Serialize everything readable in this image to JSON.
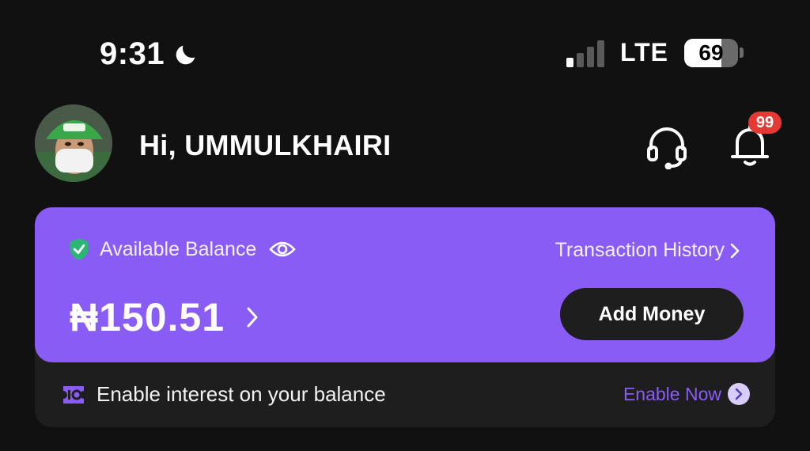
{
  "status_bar": {
    "time": "9:31",
    "network": "LTE",
    "battery": "69",
    "battery_level": 0.69,
    "icons": [
      "moon-icon",
      "signal-icon",
      "battery-icon"
    ]
  },
  "header": {
    "greeting": "Hi, UMMULKHAIRI",
    "notification_count": "99",
    "icons": [
      "avatar",
      "headset-icon",
      "bell-icon"
    ]
  },
  "balance_card": {
    "label": "Available Balance",
    "amount": "₦150.51",
    "transaction_history": "Transaction History",
    "add_money": "Add Money",
    "icons": [
      "shield-check-icon",
      "eye-icon",
      "chevron-right-icon"
    ]
  },
  "interest_banner": {
    "text": "Enable interest on your balance",
    "action": "Enable Now",
    "icons": [
      "interest-icon",
      "chevron-right-circle-icon"
    ]
  },
  "colors": {
    "background": "#111111",
    "card": "#8a5cf6",
    "card_footer": "#1e1e1e",
    "accent": "#8a5cf6",
    "badge": "#e53935",
    "shield": "#2bb673"
  }
}
